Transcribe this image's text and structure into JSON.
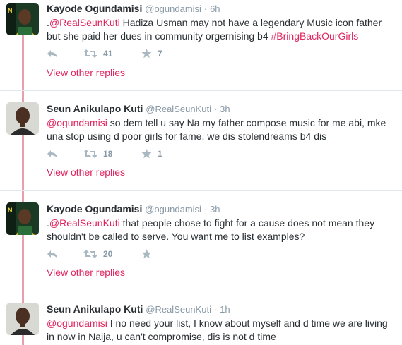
{
  "accent_color": "#e0245e",
  "tweets": [
    {
      "fullname": "Kayode Ogundamisi",
      "username": "@ogundamisi",
      "sep": "·",
      "time": "6h",
      "text_prefix": ".",
      "mention": "@RealSeunKuti",
      "text_body": " Hadiza Usman may not have a legendary Music icon father but she paid her dues in community orgernising b4 ",
      "hashtag": "#BringBackOurGirls",
      "retweets": "41",
      "favorites": "7",
      "view_replies": "View other replies",
      "avatar": "avatar-kayode"
    },
    {
      "fullname": "Seun Anikulapo Kuti",
      "username": "@RealSeunKuti",
      "sep": "·",
      "time": "3h",
      "text_prefix": "",
      "mention": "@ogundamisi",
      "text_body": " so dem tell u say Na my father compose music for me abi, mke una stop using d poor girls for fame, we dis stolendreams b4 dis",
      "hashtag": "",
      "retweets": "18",
      "favorites": "1",
      "view_replies": "View other replies",
      "avatar": "avatar-seun"
    },
    {
      "fullname": "Kayode Ogundamisi",
      "username": "@ogundamisi",
      "sep": "·",
      "time": "3h",
      "text_prefix": ".",
      "mention": "@RealSeunKuti",
      "text_body": " that people chose to fight for a cause does not mean they shouldn't be called to serve. You want me to list examples?",
      "hashtag": "",
      "retweets": "20",
      "favorites": "",
      "view_replies": "View other replies",
      "avatar": "avatar-kayode"
    },
    {
      "fullname": "Seun Anikulapo Kuti",
      "username": "@RealSeunKuti",
      "sep": "·",
      "time": "1h",
      "text_prefix": "",
      "mention": "@ogundamisi",
      "text_body": " I no need  your list, I know about myself and d time we are living in now in Naija, u can't compromise, dis is not d time",
      "hashtag": "",
      "retweets": "",
      "favorites": "",
      "view_replies": "",
      "avatar": "avatar-seun"
    }
  ]
}
